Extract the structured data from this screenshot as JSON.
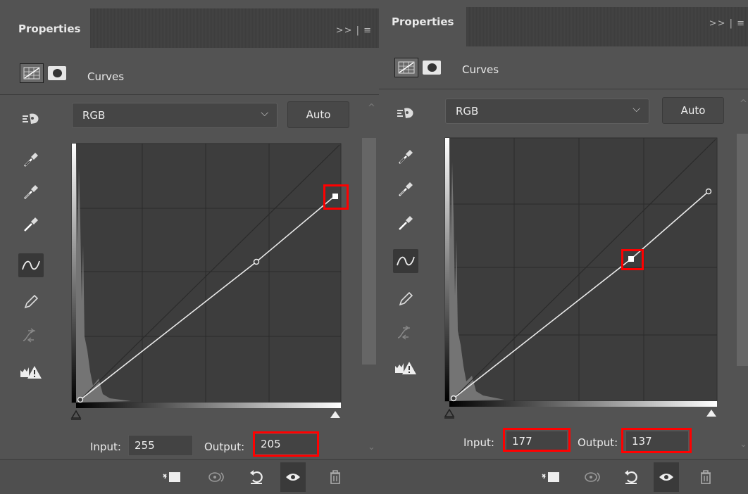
{
  "panels": [
    {
      "tab_title": "Properties",
      "tab_controls": ">>  |  ≡",
      "adjustment_name": "Curves",
      "channel": "RGB",
      "auto_label": "Auto",
      "input_label": "Input:",
      "input_value": "255",
      "output_label": "Output:",
      "output_value": "205",
      "selected_point": {
        "input": 255,
        "output": 205
      },
      "curve_points": [
        [
          0,
          0
        ],
        [
          177,
          137
        ],
        [
          255,
          205
        ]
      ]
    },
    {
      "tab_title": "Properties",
      "tab_controls": ">>  |  ≡",
      "adjustment_name": "Curves",
      "channel": "RGB",
      "auto_label": "Auto",
      "input_label": "Input:",
      "input_value": "177",
      "output_label": "Output:",
      "output_value": "137",
      "selected_point": {
        "input": 177,
        "output": 137
      },
      "curve_points": [
        [
          0,
          0
        ],
        [
          177,
          137
        ],
        [
          255,
          205
        ]
      ]
    }
  ],
  "tools": [
    "click-drag-icon",
    "black-point-eyedropper-icon",
    "gray-point-eyedropper-icon",
    "white-point-eyedropper-icon",
    "edit-points-curve-icon",
    "pencil-draw-icon",
    "smooth-curve-icon",
    "clipping-warning-icon"
  ],
  "footer_icons": [
    "clip-to-layer-icon",
    "view-previous-state-icon",
    "reset-icon",
    "visibility-eye-icon",
    "delete-icon"
  ],
  "colors": {
    "panel_bg": "#535353",
    "highlight": "#ff0000",
    "curve_line": "#e8e8e8"
  }
}
